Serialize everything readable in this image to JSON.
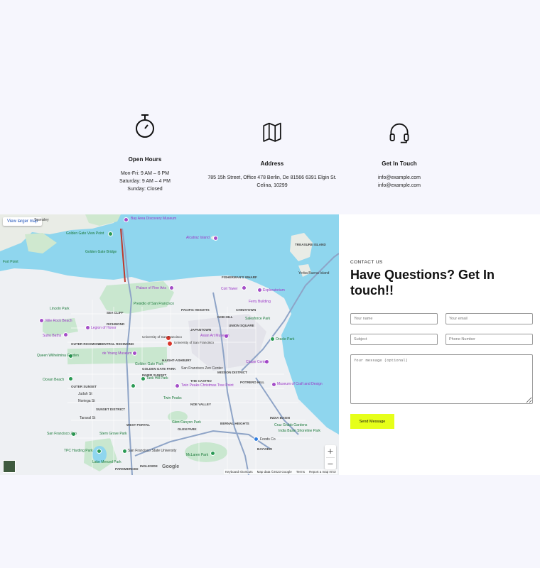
{
  "info": {
    "hours": {
      "title": "Open Hours",
      "lines": [
        "Mon-Fri: 9 AM – 6 PM",
        "Saturday: 9 AM – 4 PM",
        "Sunday: Closed"
      ],
      "icon": "stopwatch-icon"
    },
    "address": {
      "title": "Address",
      "lines": [
        "785 15h Street, Office 478 Berlin, De 81566 6391 Elgin St.",
        "Celina, 10299"
      ],
      "icon": "map-icon"
    },
    "touch": {
      "title": "Get In Touch",
      "lines": [
        "info@example.com",
        "info@example.com"
      ],
      "icon": "headset-icon"
    }
  },
  "map": {
    "larger_link": "View larger map",
    "zoom_in": "+",
    "zoom_out": "−",
    "google": "Google",
    "attribution": [
      "Keyboard shortcuts",
      "Map data ©2023 Google",
      "Terms",
      "Report a map error"
    ],
    "labels": {
      "bay_area": "Bay Area Discovery Museum",
      "ggvp": "Golden Gate View Point",
      "ggb": "Golden Gate Bridge",
      "alcatraz": "Alcatraz Island",
      "treasure": "TREASURE ISLAND",
      "yerba": "Yerba Buena Island",
      "fisherman": "FISHERMAN'S WHARF",
      "coit": "Coit Tower",
      "exploratorium": "Exploratorium",
      "palace": "Palace of Fine Arts",
      "presidio": "Presidio of San Francisco",
      "pac_heights": "PACIFIC HEIGHTS",
      "north_beach": "NOB HILL",
      "chinatown": "CHINATOWN",
      "ferry": "Ferry Building",
      "salesforce": "Salesforce Park",
      "mile_rock": "Mile Rock Beach",
      "legion": "Legion of Honor",
      "sutro": "Sutro Baths",
      "japantown": "JAPANTOWN",
      "usf1": "University of San Francisco",
      "usf2": "University of San Francisco",
      "asian_art": "Asian Art Museum",
      "union_sq": "UNION SQUARE",
      "oracle": "Oracle Park",
      "ocean_beach_w": "Queen Wilhelmina Garden",
      "young": "de Young Museum",
      "chase": "Chase Center",
      "golden_gate_park": "Golden Gate Park",
      "haight": "HAIGHT-ASHBURY",
      "castro": "THE CASTRO",
      "mission": "MISSION DISTRICT",
      "potrero": "POTRERO HILL",
      "craft": "Museum of Craft and Design",
      "ocean_beach": "Ocean Beach",
      "inner_sunset": "INNER SUNSET",
      "tank_hill": "Tank Hill Park",
      "sf_zen": "San Francisco Zen Center",
      "twin_peaks": "Twin Peaks",
      "christmas": "Twin Peaks Christmas Tree Point",
      "noe": "NOE VALLEY",
      "sunset": "SUNSET DISTRICT",
      "outer_sunset": "OUTER SUNSET",
      "west_portal": "WEST PORTAL",
      "glen_park": "GLEN PARK",
      "glen_canyon": "Glen Canyon Park",
      "bernal": "BERNAL HEIGHTS",
      "india_basin": "INDIA BASIN",
      "india_park": "India Basin Shoreline Park",
      "cruz": "Cruz Grubb Gardens",
      "sf_zoo": "San Francisco Zoo",
      "tpc": "TPC Harding Park",
      "sfsu": "San Francisco State University",
      "lake_merced": "Lake Merced Park",
      "ingleside": "INGLESIDE",
      "parkmerced": "PARKMERCED",
      "mclaren": "McLaren Park",
      "bayview": "BAYVIEW",
      "foods": "Foods Co",
      "sea_cliff": "SEA CLIFF",
      "outer_richmond": "OUTER RICHMOND",
      "richmond": "RICHMOND",
      "central_richmond": "CENTRAL RICHMOND",
      "golden_park2": "GOLDEN GATE PARK",
      "fort_point": "Fort Point",
      "sw_park": "Stern Grove Park",
      "lands_end": "Lincoln Park",
      "townsley": "Townsley",
      "noriega": "Noriega St",
      "judah": "Judah St",
      "taraval": "Taraval St"
    }
  },
  "contact": {
    "eyebrow": "CONTACT US",
    "headline": "Have Questions? Get In touch!!",
    "name_ph": "Your name",
    "email_ph": "Your email",
    "subject_ph": "Subject",
    "phone_ph": "Phone Number",
    "message_ph": "Your message (optional)",
    "send_label": "Send Message"
  }
}
